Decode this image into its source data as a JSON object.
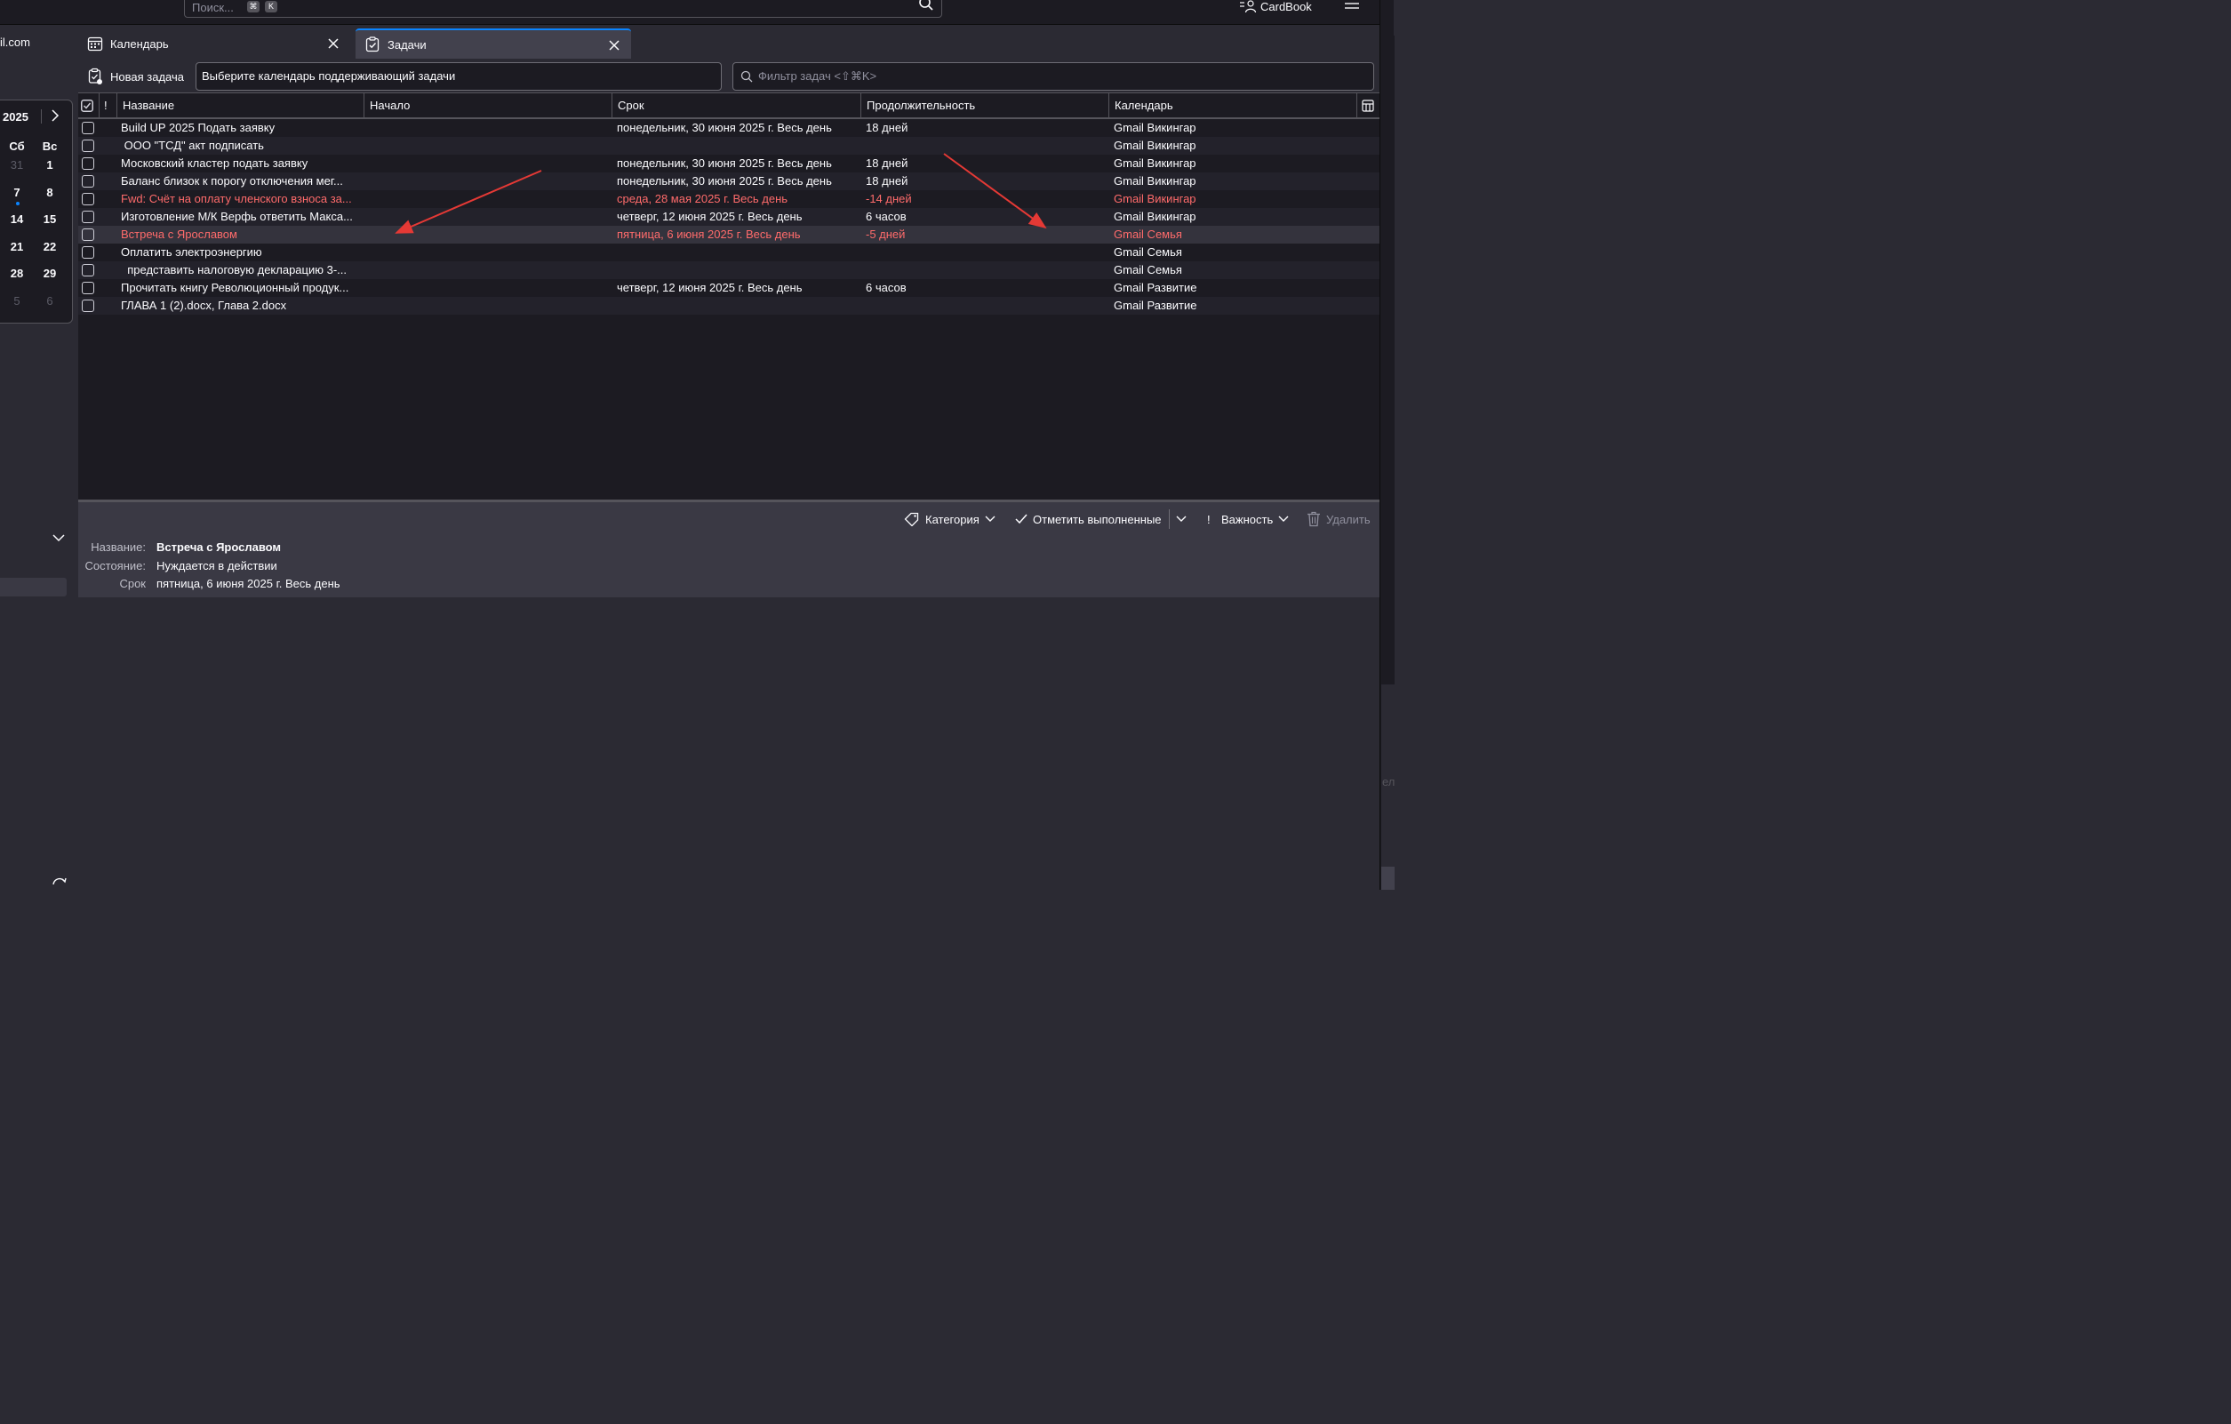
{
  "colors": {
    "accent": "#0a84ff",
    "overdue": "#ff6b6b",
    "annotation": "#e53935"
  },
  "topbar": {
    "search_placeholder": "Поиск...",
    "kbd1": "⌘",
    "kbd2": "K",
    "account": "CardBook"
  },
  "tabs": {
    "prev_fragment": "il.com",
    "calendar": "Календарь",
    "tasks": "Задачи"
  },
  "mini_calendar": {
    "year": "2025",
    "dow": [
      "Сб",
      "Вс"
    ],
    "weeks": [
      [
        "31",
        "1"
      ],
      [
        "7",
        "8"
      ],
      [
        "14",
        "15"
      ],
      [
        "21",
        "22"
      ],
      [
        "28",
        "29"
      ],
      [
        "5",
        "6"
      ]
    ]
  },
  "toolbar": {
    "new_task": "Новая задача",
    "calendar_select": "Выберите календарь поддерживающий задачи",
    "filter_placeholder": "Фильтр задач <⇧⌘K>"
  },
  "columns": {
    "priority": "!",
    "title": "Название",
    "start": "Начало",
    "due": "Срок",
    "duration": "Продолжительность",
    "calendar": "Календарь"
  },
  "tasks": [
    {
      "title": "Build UP 2025 Подать заявку",
      "due": "понедельник, 30 июня 2025 г. Весь день",
      "duration": "18 дней",
      "calendar": "Gmail Викингар",
      "overdue": false
    },
    {
      "title": " ООО \"ТСД\" акт подписать",
      "due": "",
      "duration": "",
      "calendar": "Gmail Викингар",
      "overdue": false
    },
    {
      "title": "Московский кластер подать заявку",
      "due": "понедельник, 30 июня 2025 г. Весь день",
      "duration": "18 дней",
      "calendar": "Gmail Викингар",
      "overdue": false
    },
    {
      "title": "Баланс близок к порогу отключения мег...",
      "due": "понедельник, 30 июня 2025 г. Весь день",
      "duration": "18 дней",
      "calendar": "Gmail Викингар",
      "overdue": false
    },
    {
      "title": "Fwd: Счёт на оплату членского взноса за...",
      "due": "среда, 28 мая 2025 г. Весь день",
      "duration": "-14 дней",
      "calendar": "Gmail Викингар",
      "overdue": true
    },
    {
      "title": "Изготовление М/К Верфь ответить Макса...",
      "due": "четверг, 12 июня 2025 г. Весь день",
      "duration": "6 часов",
      "calendar": "Gmail Викингар",
      "overdue": false
    },
    {
      "title": "Встреча с Ярославом",
      "due": "пятница, 6 июня 2025 г. Весь день",
      "duration": "-5 дней",
      "calendar": "Gmail Семья",
      "overdue": true
    },
    {
      "title": "Оплатить электроэнергию",
      "due": "",
      "duration": "",
      "calendar": "Gmail Семья",
      "overdue": false
    },
    {
      "title": "  представить налоговую декларацию 3-...",
      "due": "",
      "duration": "",
      "calendar": "Gmail Семья",
      "overdue": false
    },
    {
      "title": "Прочитать книгу Революционный продук...",
      "due": "четверг, 12 июня 2025 г. Весь день",
      "duration": "6 часов",
      "calendar": "Gmail Развитие",
      "overdue": false
    },
    {
      "title": "ГЛАВА 1 (2).docx, Глава 2.docx",
      "due": "",
      "duration": "",
      "calendar": "Gmail Развитие",
      "overdue": false
    }
  ],
  "details": {
    "actions": {
      "category": "Категория",
      "mark_done": "Отметить выполненные",
      "priority_mark": "!",
      "priority": "Важность",
      "delete": "Удалить"
    },
    "labels": {
      "title": "Название:",
      "status": "Состояние:",
      "due": "Срок"
    },
    "values": {
      "title": "Встреча с Ярославом",
      "status": "Нуждается в действии",
      "due": "пятница, 6 июня 2025 г. Весь день"
    }
  },
  "right_edge_fragment": "ел"
}
